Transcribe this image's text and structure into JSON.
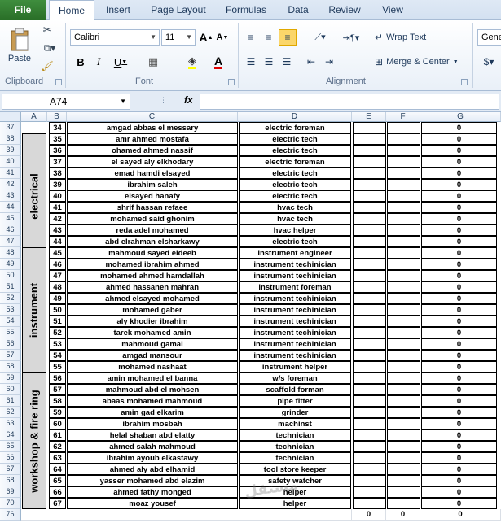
{
  "tabs": [
    {
      "label": "File"
    },
    {
      "label": "Home"
    },
    {
      "label": "Insert"
    },
    {
      "label": "Page Layout"
    },
    {
      "label": "Formulas"
    },
    {
      "label": "Data"
    },
    {
      "label": "Review"
    },
    {
      "label": "View"
    }
  ],
  "ribbon": {
    "clipboard": {
      "paste_label": "Paste",
      "group_label": "Clipboard"
    },
    "font": {
      "font_name": "Calibri",
      "font_size": "11",
      "group_label": "Font",
      "grow_label": "A",
      "shrink_label": "A",
      "bold": "B",
      "italic": "I",
      "underline": "U",
      "font_color_label": "A"
    },
    "alignment": {
      "wrap_text": "Wrap Text",
      "merge_center": "Merge & Center",
      "group_label": "Alignment"
    },
    "number": {
      "format_partial": "Gene"
    }
  },
  "formula_bar": {
    "name_box": "A74",
    "fx": "fx",
    "formula": ""
  },
  "columns": [
    "A",
    "B",
    "C",
    "D",
    "E",
    "F",
    "G"
  ],
  "categories": [
    "electrical",
    "instrument",
    "workshop & fire ring"
  ],
  "rows": [
    {
      "row": "37",
      "no": "34",
      "name": "amgad abbas el messary",
      "job": "electric foreman",
      "g": "0"
    },
    {
      "row": "38",
      "no": "35",
      "name": "amr ahmed mostafa",
      "job": "electric tech",
      "g": "0"
    },
    {
      "row": "39",
      "no": "36",
      "name": "ohamed ahmed nassif",
      "job": "electric tech",
      "g": "0"
    },
    {
      "row": "40",
      "no": "37",
      "name": "el sayed aly elkhodary",
      "job": "electric foreman",
      "g": "0"
    },
    {
      "row": "41",
      "no": "38",
      "name": "emad hamdi elsayed",
      "job": "electric tech",
      "g": "0"
    },
    {
      "row": "42",
      "no": "39",
      "name": "ibrahim saleh",
      "job": "electric tech",
      "g": "0"
    },
    {
      "row": "43",
      "no": "40",
      "name": "elsayed hanafy",
      "job": "electric tech",
      "g": "0"
    },
    {
      "row": "44",
      "no": "41",
      "name": "shrif hassan refaee",
      "job": "hvac tech",
      "g": "0"
    },
    {
      "row": "45",
      "no": "42",
      "name": "mohamed said ghonim",
      "job": "hvac tech",
      "g": "0"
    },
    {
      "row": "46",
      "no": "43",
      "name": "reda adel mohamed",
      "job": "hvac helper",
      "g": "0"
    },
    {
      "row": "47",
      "no": "44",
      "name": "abd elrahman elsharkawy",
      "job": "electric tech",
      "g": "0"
    },
    {
      "row": "48",
      "no": "45",
      "name": "mahmoud sayed eldeeb",
      "job": "instrument engineer",
      "g": "0"
    },
    {
      "row": "49",
      "no": "46",
      "name": "mohamed ibrahim ahmed",
      "job": "instrument techinician",
      "g": "0"
    },
    {
      "row": "50",
      "no": "47",
      "name": "mohamed ahmed hamdallah",
      "job": "instrument techinician",
      "g": "0"
    },
    {
      "row": "51",
      "no": "48",
      "name": "ahmed hassanen mahran",
      "job": "instrument foreman",
      "g": "0"
    },
    {
      "row": "52",
      "no": "49",
      "name": "ahmed elsayed mohamed",
      "job": "instrument techinician",
      "g": "0"
    },
    {
      "row": "53",
      "no": "50",
      "name": "mohamed gaber",
      "job": "instrument techinician",
      "g": "0"
    },
    {
      "row": "54",
      "no": "51",
      "name": "aly khodier ibrahim",
      "job": "instrument techinician",
      "g": "0"
    },
    {
      "row": "55",
      "no": "52",
      "name": "tarek mohamed amin",
      "job": "instrument techinician",
      "g": "0"
    },
    {
      "row": "56",
      "no": "53",
      "name": "mahmoud gamal",
      "job": "instrument techinician",
      "g": "0"
    },
    {
      "row": "57",
      "no": "54",
      "name": "amgad mansour",
      "job": "instrument techinician",
      "g": "0"
    },
    {
      "row": "58",
      "no": "55",
      "name": "mohamed nashaat",
      "job": "instrument helper",
      "g": "0"
    },
    {
      "row": "59",
      "no": "56",
      "name": "amin mohamed el banna",
      "job": "w/s foreman",
      "g": "0"
    },
    {
      "row": "60",
      "no": "57",
      "name": "mahmoud abd el mohsen",
      "job": "scaffold forman",
      "g": "0"
    },
    {
      "row": "61",
      "no": "58",
      "name": "abaas mohamed mahmoud",
      "job": "pipe fitter",
      "g": "0"
    },
    {
      "row": "62",
      "no": "59",
      "name": "amin gad elkarim",
      "job": "grinder",
      "g": "0"
    },
    {
      "row": "63",
      "no": "60",
      "name": "ibrahim mosbah",
      "job": "machinst",
      "g": "0"
    },
    {
      "row": "64",
      "no": "61",
      "name": "helal shaban abd elatty",
      "job": "technician",
      "g": "0"
    },
    {
      "row": "65",
      "no": "62",
      "name": "ahmed salah mahmoud",
      "job": "technician",
      "g": "0"
    },
    {
      "row": "66",
      "no": "63",
      "name": "ibrahim ayoub elkastawy",
      "job": "technician",
      "g": "0"
    },
    {
      "row": "67",
      "no": "64",
      "name": "ahmed aly abd elhamid",
      "job": "tool store keeper",
      "g": "0"
    },
    {
      "row": "68",
      "no": "65",
      "name": "yasser mohamed abd elazim",
      "job": "safety watcher",
      "g": "0"
    },
    {
      "row": "69",
      "no": "66",
      "name": "ahmed fathy monged",
      "job": "helper",
      "g": "0"
    },
    {
      "row": "70",
      "no": "67",
      "name": "moaz yousef",
      "job": "helper",
      "g": "0"
    }
  ],
  "total_row": {
    "row": "76",
    "e": "0",
    "f": "0",
    "g": "0"
  },
  "watermark": "مستقل"
}
